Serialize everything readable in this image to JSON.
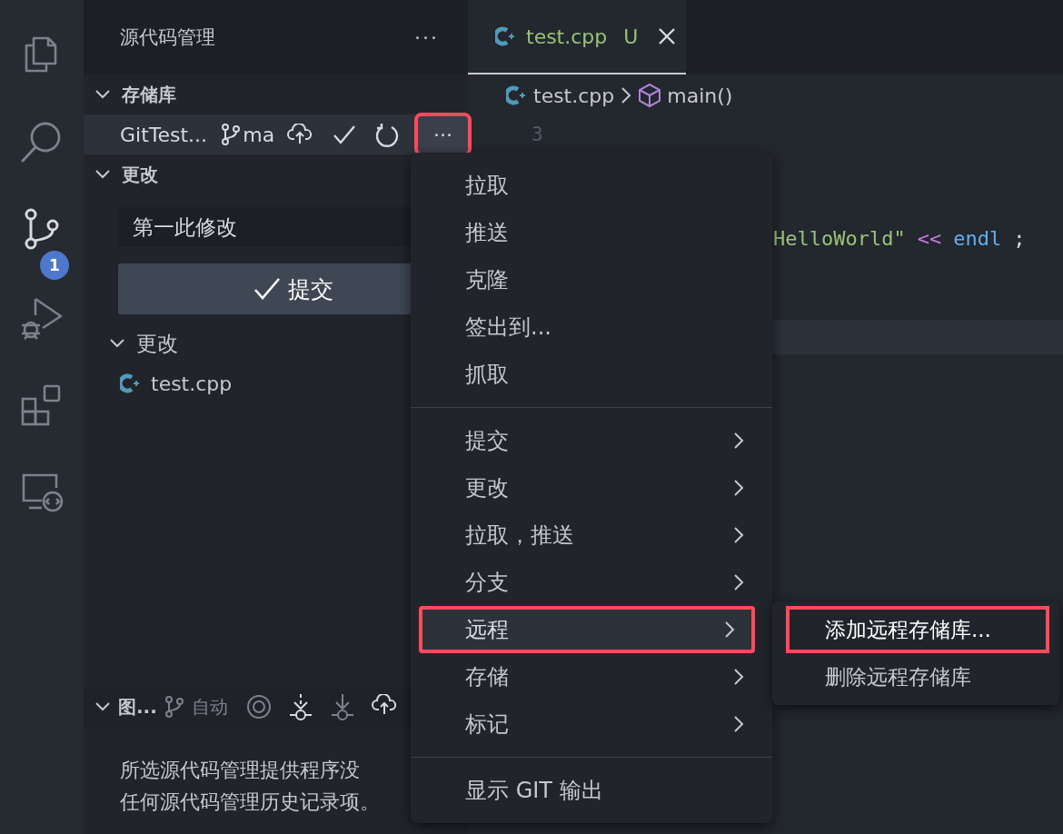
{
  "activity_bar": {
    "items": [
      {
        "kind": "files",
        "selected": false
      },
      {
        "kind": "search",
        "selected": false
      },
      {
        "kind": "source-control",
        "selected": true,
        "badge": "1"
      },
      {
        "kind": "run-debug",
        "selected": false
      },
      {
        "kind": "extensions",
        "selected": false
      },
      {
        "kind": "remote",
        "selected": false
      }
    ]
  },
  "sidebar": {
    "title": "源代码管理",
    "more": "···",
    "repositories": {
      "header": "存储库",
      "expanded": true,
      "repo": {
        "name": "GitTest...",
        "branch": "ma",
        "more_highlighted": true
      }
    },
    "changes": {
      "header": "更改",
      "expanded": true,
      "message": "第一此修改",
      "commit_button": "提交",
      "groups": [
        {
          "label": "更改",
          "expanded": true,
          "files": [
            {
              "name": "test.cpp"
            }
          ]
        }
      ]
    },
    "graph": {
      "header": "图...",
      "mode": "自动",
      "expanded": true,
      "message": [
        "所选源代码管理提供程序没",
        "任何源代码管理历史记录项。"
      ]
    }
  },
  "editor": {
    "tabs": [
      {
        "label": "test.cpp",
        "status": "U",
        "selected": true
      }
    ],
    "breadcrumb": {
      "file": "test.cpp",
      "symbol": "main()"
    },
    "line_number": "3",
    "code": [
      {
        "text": "HelloWorld\"",
        "color": "#98c379"
      },
      {
        "text": "<<",
        "color": "#c678dd"
      },
      {
        "text": "endl",
        "color": "#61afef"
      },
      {
        "text": ";",
        "color": "#d7dae0"
      }
    ]
  },
  "context_menu": {
    "groups": [
      [
        {
          "label": "拉取",
          "submenu": false,
          "highlighted": false
        },
        {
          "label": "推送",
          "submenu": false,
          "highlighted": false
        },
        {
          "label": "克隆",
          "submenu": false,
          "highlighted": false
        },
        {
          "label": "签出到...",
          "submenu": false,
          "highlighted": false
        },
        {
          "label": "抓取",
          "submenu": false,
          "highlighted": false
        }
      ],
      [
        {
          "label": "提交",
          "submenu": true,
          "highlighted": false
        },
        {
          "label": "更改",
          "submenu": true,
          "highlighted": false
        },
        {
          "label": "拉取，推送",
          "submenu": true,
          "highlighted": false
        },
        {
          "label": "分支",
          "submenu": true,
          "highlighted": false
        },
        {
          "label": "远程",
          "submenu": true,
          "highlighted": true
        },
        {
          "label": "存储",
          "submenu": true,
          "highlighted": false
        },
        {
          "label": "标记",
          "submenu": true,
          "highlighted": false
        }
      ],
      [
        {
          "label": "显示 GIT 输出",
          "submenu": false,
          "highlighted": false
        }
      ]
    ]
  },
  "submenu": {
    "items": [
      {
        "label": "添加远程存储库...",
        "highlighted": true
      },
      {
        "label": "删除远程存储库",
        "highlighted": false
      }
    ]
  }
}
